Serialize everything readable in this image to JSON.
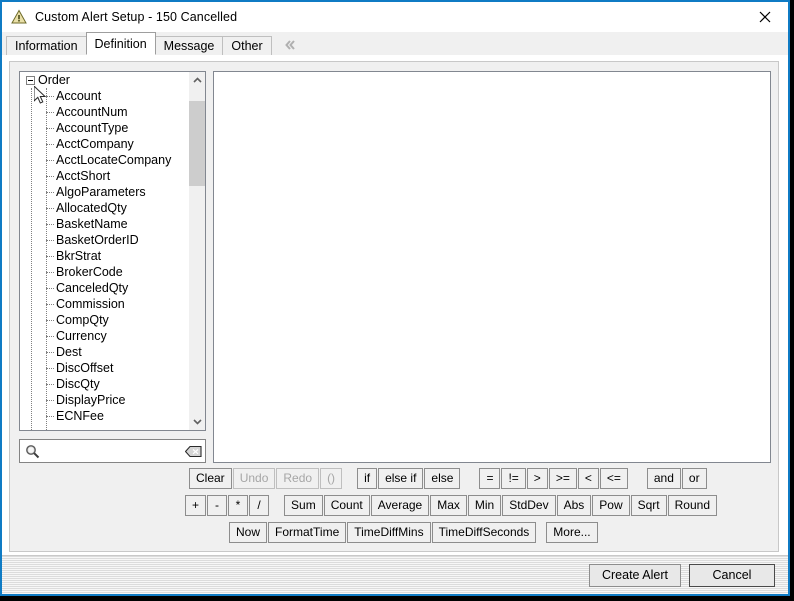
{
  "window": {
    "title": "Custom Alert Setup - 150 Cancelled",
    "title_icon": "warning-triangle-icon",
    "close_icon": "close-icon",
    "accent_color": "#0f7bc4"
  },
  "tabs": {
    "items": [
      {
        "label": "Information",
        "selected": false
      },
      {
        "label": "Definition",
        "selected": true
      },
      {
        "label": "Message",
        "selected": false
      },
      {
        "label": "Other",
        "selected": false
      }
    ],
    "overflow_icon": "double-chevron-left-icon"
  },
  "tree": {
    "root": {
      "label": "Order",
      "expanded": true,
      "toggle_icon": "minus-box-icon"
    },
    "children": [
      "Account",
      "AccountNum",
      "AccountType",
      "AcctCompany",
      "AcctLocateCompany",
      "AcctShort",
      "AlgoParameters",
      "AllocatedQty",
      "BasketName",
      "BasketOrderID",
      "BkrStrat",
      "BrokerCode",
      "CanceledQty",
      "Commission",
      "CompQty",
      "Currency",
      "Dest",
      "DiscOffset",
      "DiscQty",
      "DisplayPrice",
      "ECNFee"
    ],
    "scrollbar": {
      "up_icon": "chevron-up-icon",
      "down_icon": "chevron-down-icon"
    }
  },
  "search": {
    "value": "",
    "placeholder": "",
    "icon": "search-icon",
    "clear_icon": "backspace-clear-icon"
  },
  "editor": {
    "content": ""
  },
  "buttons": {
    "row1": [
      {
        "label": "Clear",
        "disabled": false
      },
      {
        "label": "Undo",
        "disabled": true
      },
      {
        "label": "Redo",
        "disabled": true
      },
      {
        "label": "()",
        "disabled": true
      },
      {
        "gap": "md"
      },
      {
        "label": "if",
        "disabled": false
      },
      {
        "label": "else if",
        "disabled": false
      },
      {
        "label": "else",
        "disabled": false
      },
      {
        "gap": "lg"
      },
      {
        "label": "=",
        "disabled": false
      },
      {
        "label": "!=",
        "disabled": false
      },
      {
        "label": ">",
        "disabled": false
      },
      {
        "label": ">=",
        "disabled": false
      },
      {
        "label": "<",
        "disabled": false
      },
      {
        "label": "<=",
        "disabled": false
      },
      {
        "gap": "lg"
      },
      {
        "label": "and",
        "disabled": false
      },
      {
        "label": "or",
        "disabled": false
      }
    ],
    "row2": [
      {
        "label": "+",
        "disabled": false
      },
      {
        "label": "-",
        "disabled": false
      },
      {
        "label": "*",
        "disabled": false
      },
      {
        "label": "/",
        "disabled": false
      },
      {
        "gap": "md"
      },
      {
        "label": "Sum",
        "disabled": false
      },
      {
        "label": "Count",
        "disabled": false
      },
      {
        "label": "Average",
        "disabled": false
      },
      {
        "label": "Max",
        "disabled": false
      },
      {
        "label": "Min",
        "disabled": false
      },
      {
        "label": "StdDev",
        "disabled": false
      },
      {
        "label": "Abs",
        "disabled": false
      },
      {
        "label": "Pow",
        "disabled": false
      },
      {
        "label": "Sqrt",
        "disabled": false
      },
      {
        "label": "Round",
        "disabled": false
      }
    ],
    "row3": [
      {
        "label": "Now",
        "disabled": false
      },
      {
        "label": "FormatTime",
        "disabled": false
      },
      {
        "label": "TimeDiffMins",
        "disabled": false
      },
      {
        "label": "TimeDiffSeconds",
        "disabled": false
      },
      {
        "gap": "sm"
      },
      {
        "label": "More...",
        "disabled": false
      }
    ]
  },
  "footer": {
    "create_label": "Create Alert",
    "cancel_label": "Cancel"
  }
}
